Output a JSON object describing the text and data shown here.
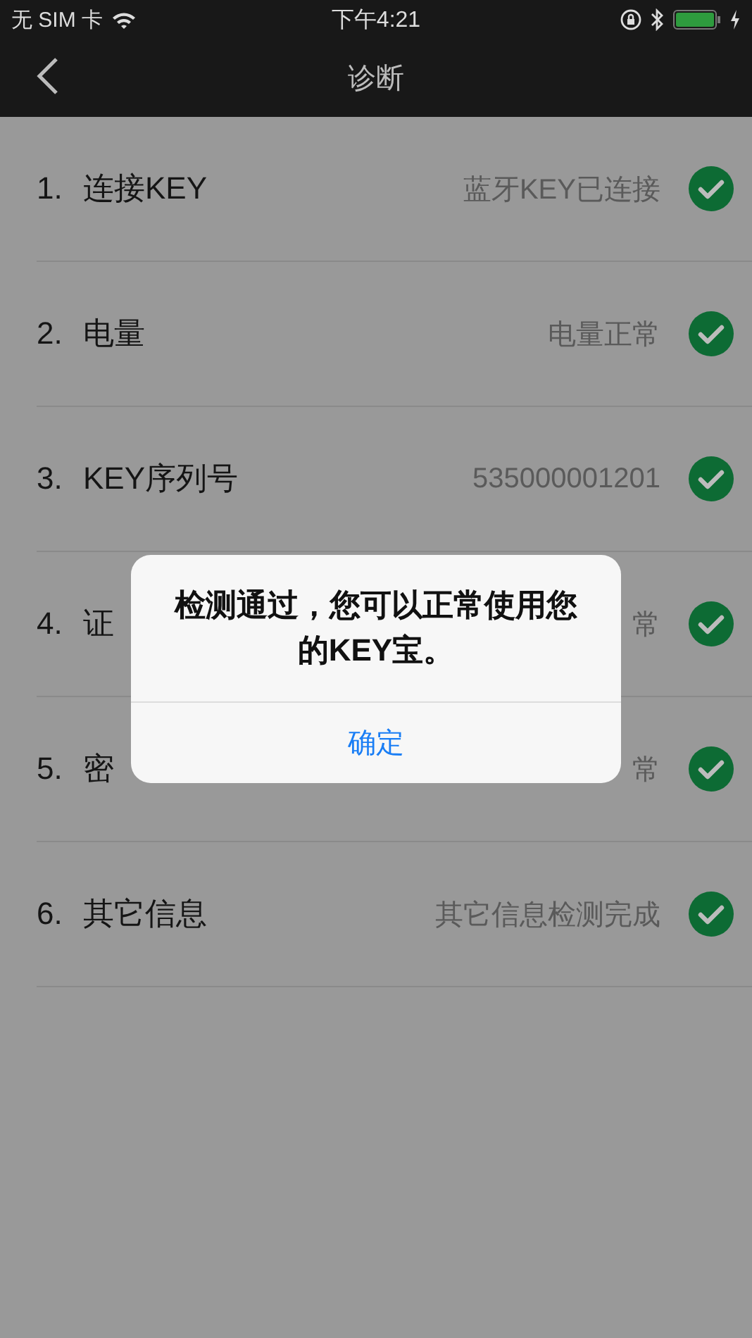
{
  "status_bar": {
    "carrier": "无 SIM 卡",
    "time": "下午4:21"
  },
  "nav": {
    "title": "诊断"
  },
  "items": [
    {
      "number": "1.",
      "label": "连接KEY",
      "value": "蓝牙KEY已连接",
      "checked": true
    },
    {
      "number": "2.",
      "label": "电量",
      "value": "电量正常",
      "checked": true
    },
    {
      "number": "3.",
      "label": "KEY序列号",
      "value": "535000001201",
      "checked": true
    },
    {
      "number": "4.",
      "label": "证",
      "value": "常",
      "checked": true
    },
    {
      "number": "5.",
      "label": "密",
      "value": "常",
      "checked": true
    },
    {
      "number": "6.",
      "label": "其它信息",
      "value": "其它信息检测完成",
      "checked": true
    }
  ],
  "dialog": {
    "message": "检测通过，您可以正常使用您的KEY宝。",
    "button": "确定"
  }
}
